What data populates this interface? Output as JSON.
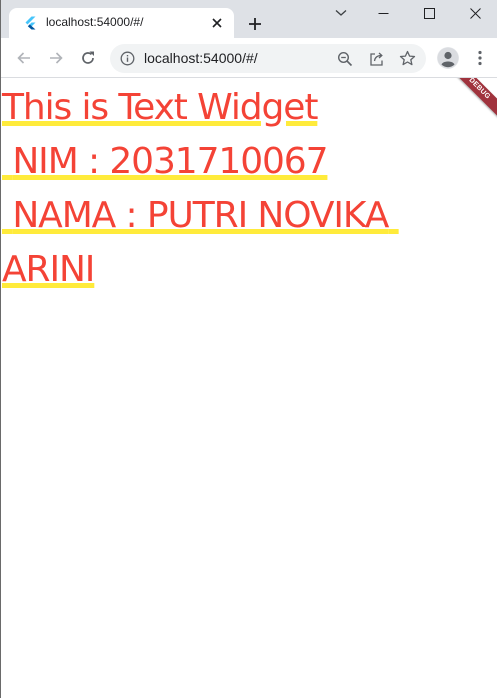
{
  "browser": {
    "tab": {
      "title": "localhost:54000/#/",
      "favicon": "flutter-icon"
    },
    "new_tab_symbol": "+",
    "window_controls": [
      "minimize-icon",
      "maximize-icon",
      "close-icon"
    ],
    "toolbar": {
      "back": "back-arrow-icon",
      "forward": "forward-arrow-icon",
      "reload": "reload-icon",
      "url": "localhost:54000/#/",
      "omnibox_icons": [
        "zoom-icon",
        "share-icon",
        "bookmark-star-icon"
      ],
      "profile": "profile-icon",
      "menu": "kebab-menu-icon"
    }
  },
  "page": {
    "text": "This is Text Widget\n NIM : 2031710067\n NAMA : PUTRI NOVIKA ARINI",
    "text_color": "#f44336",
    "underline_color": "#ffeb3b",
    "debug_banner": "DEBUG",
    "debug_banner_color": "#a0333d"
  }
}
